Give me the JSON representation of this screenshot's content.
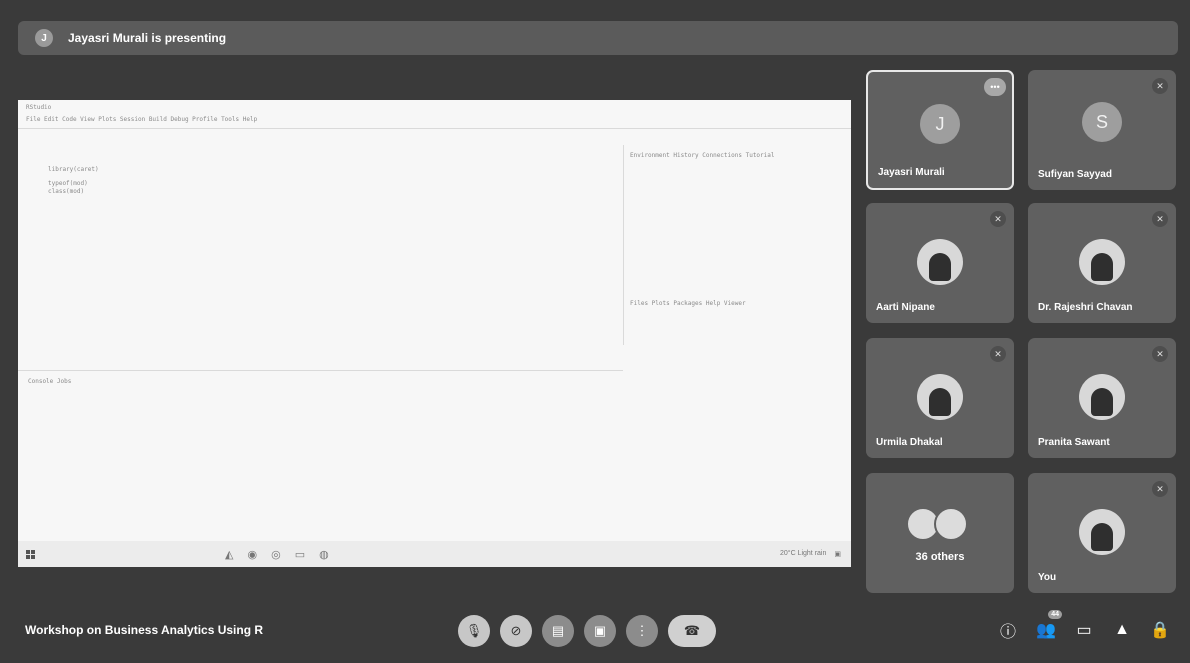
{
  "banner": {
    "avatar_letter": "J",
    "text": "Jayasri Murali is presenting"
  },
  "screen": {
    "rows": [
      "File  Edit  Code  View  Plots  Session  Build  Debug  Profile  Tools  Help",
      "library(caret)",
      "typeof(mod)",
      "class(mod)",
      "Environment  History  Connections  Tutorial",
      "Files  Plots  Packages  Help  Viewer",
      "Console  Jobs",
      "20°C Light rain"
    ]
  },
  "participants": [
    {
      "name": "Jayasri Murali",
      "letter": "J",
      "type": "letter",
      "active": true
    },
    {
      "name": "Sufiyan Sayyad",
      "letter": "S",
      "type": "letter",
      "muted": true
    },
    {
      "name": "Aarti Nipane",
      "type": "photo",
      "muted": true
    },
    {
      "name": "Dr. Rajeshri Chavan",
      "type": "photo",
      "muted": true
    },
    {
      "name": "Urmila Dhakal",
      "type": "photo",
      "muted": true
    },
    {
      "name": "Pranita Sawant",
      "type": "photo",
      "muted": true
    },
    {
      "name": "36 others",
      "type": "group"
    },
    {
      "name": "You",
      "type": "photo",
      "muted": true
    }
  ],
  "bottom": {
    "meeting_title": "Workshop on Business Analytics Using R",
    "people_count": "44"
  }
}
